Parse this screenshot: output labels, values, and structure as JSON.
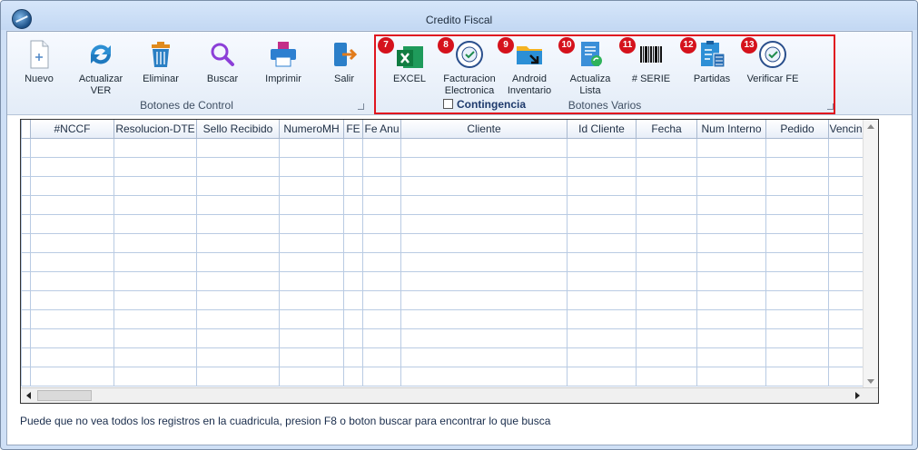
{
  "window": {
    "title": "Credito Fiscal"
  },
  "control_group": {
    "label": "Botones de Control",
    "buttons": [
      {
        "label": "Nuevo",
        "icon": "new-document-icon"
      },
      {
        "label": "Actualizar VER",
        "icon": "refresh-icon"
      },
      {
        "label": "Eliminar",
        "icon": "trash-icon"
      },
      {
        "label": "Buscar",
        "icon": "search-icon"
      },
      {
        "label": "Imprimir",
        "icon": "printer-icon"
      },
      {
        "label": "Salir",
        "icon": "exit-door-icon"
      }
    ]
  },
  "various_group": {
    "label": "Botones Varios",
    "contingencia_label": "Contingencia",
    "contingencia_checked": false,
    "buttons": [
      {
        "badge": "7",
        "label": "EXCEL",
        "icon": "excel-icon"
      },
      {
        "badge": "8",
        "label": "Facturacion Electronica",
        "icon": "facturacion-electronica-seal-icon"
      },
      {
        "badge": "9",
        "label": "Android Inventario",
        "icon": "folder-arrow-icon"
      },
      {
        "badge": "10",
        "label": "Actualiza Lista",
        "icon": "update-list-icon"
      },
      {
        "badge": "11",
        "label": "# SERIE",
        "icon": "barcode-icon"
      },
      {
        "badge": "12",
        "label": "Partidas",
        "icon": "clipboard-calculator-icon"
      },
      {
        "badge": "13",
        "label": "Verificar FE",
        "icon": "verify-seal-icon"
      }
    ]
  },
  "grid": {
    "columns": [
      "#NCCF",
      "Resolucion-DTE",
      "Sello Recibido",
      "NumeroMH",
      "FE",
      "Fe Anu",
      "Cliente",
      "Id Cliente",
      "Fecha",
      "Num Interno",
      "Pedido",
      "Vencin"
    ]
  },
  "footer": {
    "message": "Puede que no vea todos los registros en la cuadricula, presion F8 o boton buscar para encontrar lo que busca"
  },
  "colors": {
    "badge": "#d5121c",
    "highlight_border": "#e0161f",
    "grid_line": "#b9cbe3"
  }
}
